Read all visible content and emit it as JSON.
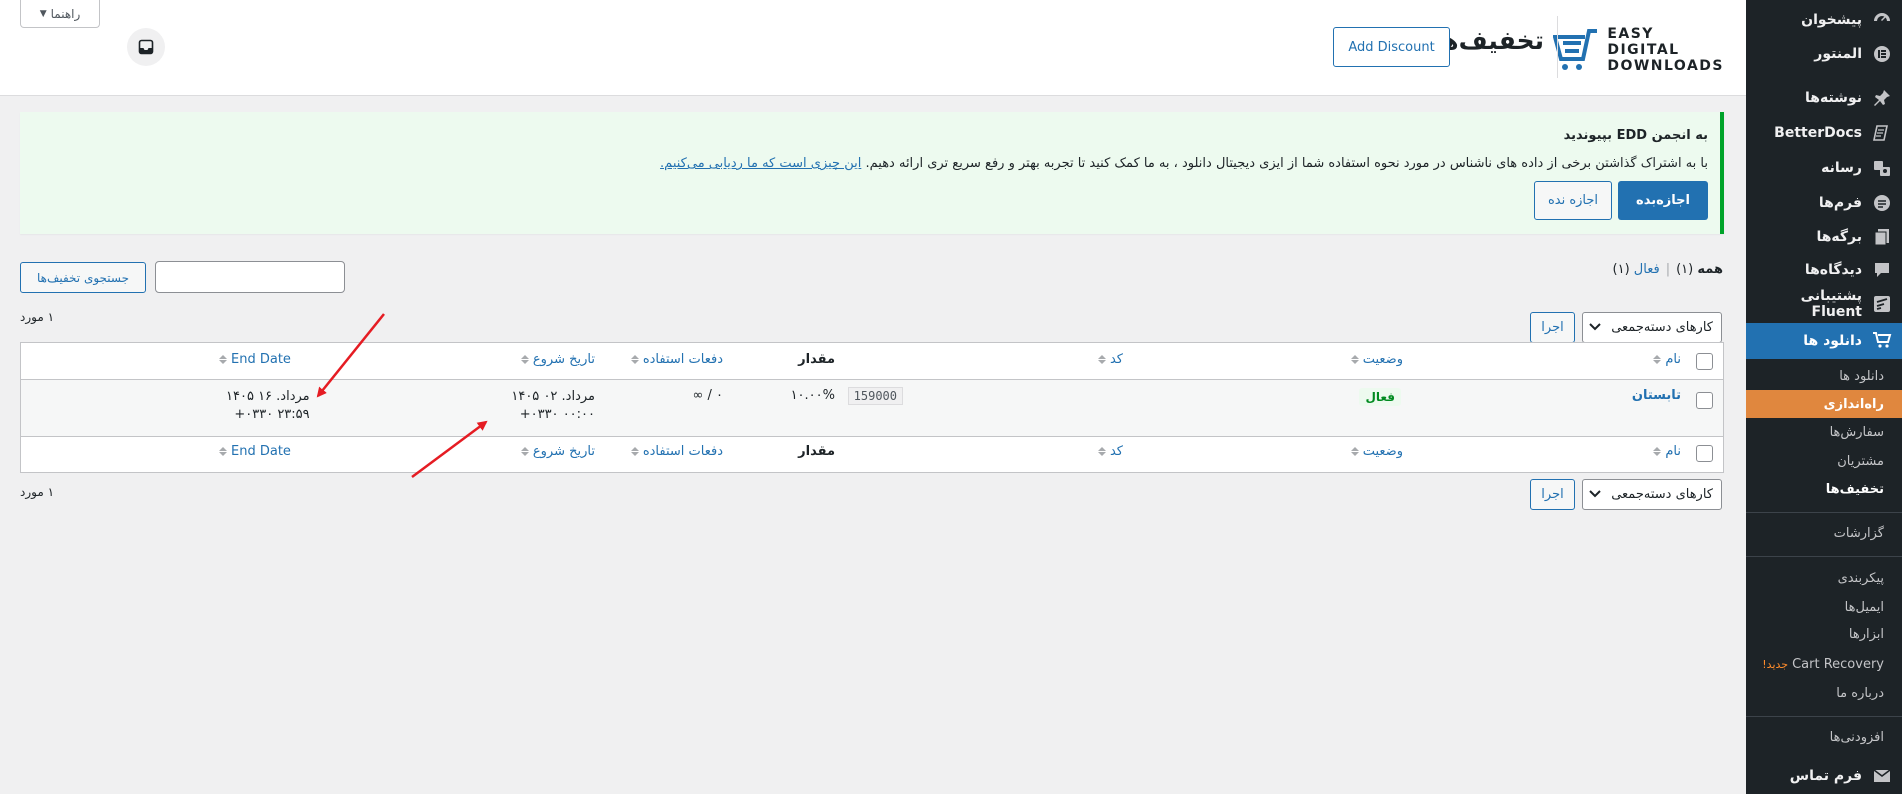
{
  "sidebar": {
    "items": [
      {
        "label": "پیشخوان",
        "icon": "dashboard-icon"
      },
      {
        "label": "المنتور",
        "icon": "elementor-icon"
      },
      {
        "label": "نوشته‌ها",
        "icon": "pin-icon"
      },
      {
        "label": "BetterDocs",
        "icon": "betterdocs-icon"
      },
      {
        "label": "رسانه",
        "icon": "media-icon"
      },
      {
        "label": "فرم‌ها",
        "icon": "forms-icon"
      },
      {
        "label": "برگه‌ها",
        "icon": "pages-icon"
      },
      {
        "label": "دیدگاه‌ها",
        "icon": "comments-icon"
      },
      {
        "label": "پشتیبانی Fluent",
        "icon": "fluent-support-icon"
      },
      {
        "label": "دانلود ها",
        "icon": "cart-icon"
      }
    ],
    "submenu": [
      "دانلود ها",
      "راه‌اندازی",
      "سفارش‌ها",
      "مشتریان",
      "تخفیف‌ها",
      "گزارشات",
      "پیکربندی",
      "ایمیل‌ها",
      "ابزارها",
      "Cart Recovery",
      "درباره ما",
      "افزودنی‌ها"
    ],
    "new_badge": "جدید!",
    "contact": {
      "label": "فرم تماس",
      "icon": "mail-icon"
    }
  },
  "header": {
    "logo_line1": "EASY",
    "logo_line2": "DIGITAL",
    "logo_line3": "DOWNLOADS",
    "title": "تخفیف‌ها",
    "add_discount": "Add Discount",
    "help": "راهنما"
  },
  "notice": {
    "title": "به انجمن EDD بپیوندید",
    "text": "با به اشتراک گذاشتن برخی از داده های ناشناس در مورد نحوه استفاده شما از ایزی دیجیتال دانلود ، به ما کمک کنید تا تجربه بهتر و رفع سریع تری ارائه دهیم.",
    "link": "این چیزی است که ما ردیابی می‌کنیم.",
    "allow": "اجازه‌بده",
    "deny": "اجازه نده"
  },
  "filters": {
    "all": "همه",
    "all_count": "(۱)",
    "active": "فعال",
    "active_count": "(۱)",
    "separator": "|"
  },
  "search": {
    "button": "جستجوی تخفیف‌ها",
    "placeholder": ""
  },
  "bulk": {
    "label": "کارهای دسته‌جمعی",
    "apply": "اجرا",
    "count": "۱ مورد"
  },
  "columns": {
    "name": "نام",
    "status": "وضعیت",
    "code": "کد",
    "amount": "مقدار",
    "uses": "دفعات استفاده",
    "start": "تاریخ شروع",
    "end": "End Date"
  },
  "rows": [
    {
      "name": "تابستان",
      "status": "فعال",
      "code": "159000",
      "amount": "۱۰.۰۰%",
      "uses": "۰ / ∞",
      "start_line1": "مرداد. ۰۲ ۱۴۰۵",
      "start_line2": "۰۰:۰۰ ۰۳۳۰+",
      "end_line1": "مرداد. ۱۶ ۱۴۰۵",
      "end_line2": "۲۳:۵۹ ۰۳۳۰+"
    }
  ],
  "colors": {
    "accent": "#2271b1",
    "highlight": "#e0873e",
    "sidebar": "#1d2327",
    "arrow": "#e51c23"
  }
}
